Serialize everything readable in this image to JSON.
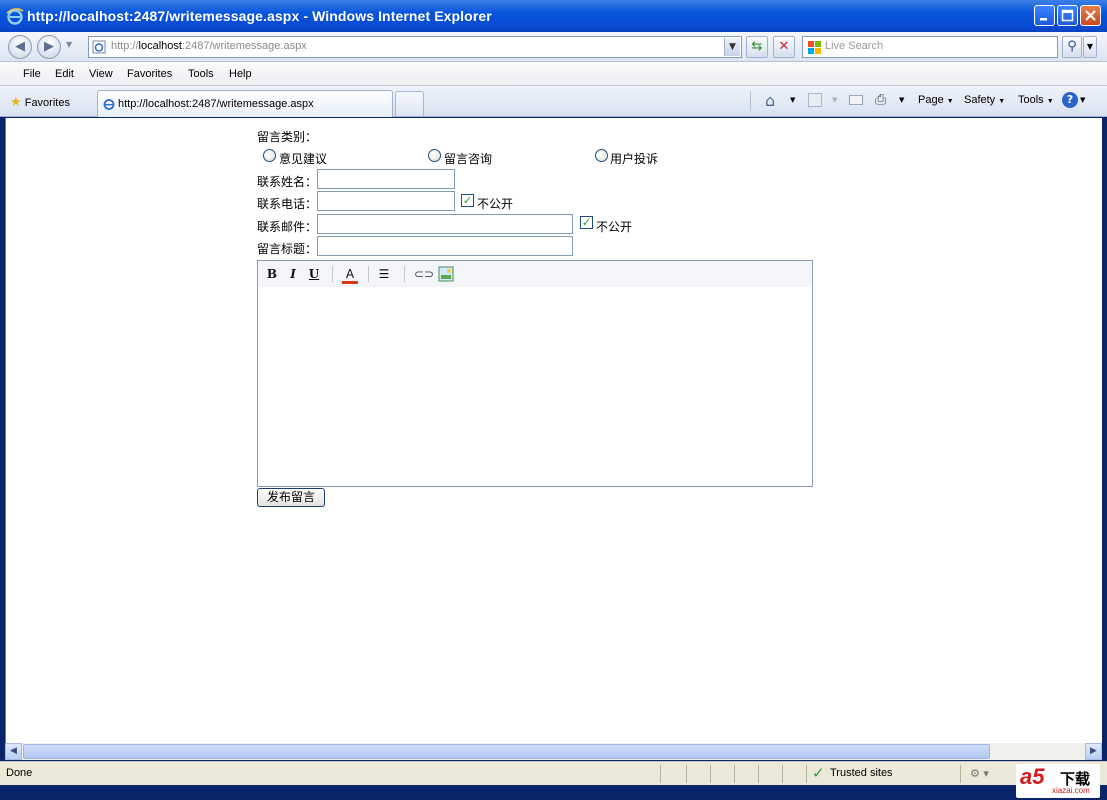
{
  "window": {
    "title": "http://localhost:2487/writemessage.aspx - Windows Internet Explorer"
  },
  "address_bar": {
    "url_prefix": "http://",
    "url_host": "localhost",
    "url_rest": ":2487/writemessage.aspx",
    "search_placeholder": "Live Search"
  },
  "menu": {
    "items": [
      "File",
      "Edit",
      "View",
      "Favorites",
      "Tools",
      "Help"
    ]
  },
  "favorites_bar": {
    "favorites_label": "Favorites",
    "tab_label": "http://localhost:2487/writemessage.aspx",
    "commands": [
      "Page",
      "Safety",
      "Tools"
    ]
  },
  "form": {
    "category_label": "留言类别：",
    "categories": [
      "意见建议",
      "留言咨询",
      "用户投诉"
    ],
    "name_label": "联系姓名：",
    "phone_label": "联系电话：",
    "email_label": "联系邮件：",
    "title_label": "留言标题：",
    "private_label": "不公开",
    "phone_private_checked": true,
    "email_private_checked": true,
    "submit_label": "发布留言"
  },
  "editor_toolbar": {
    "bold": "B",
    "italic": "I",
    "underline": "U",
    "font_color": "A"
  },
  "status_bar": {
    "status": "Done",
    "zone": "Trusted sites"
  },
  "watermark": {
    "brand": "a5",
    "download": "下载",
    "site": "xiazai.com"
  }
}
